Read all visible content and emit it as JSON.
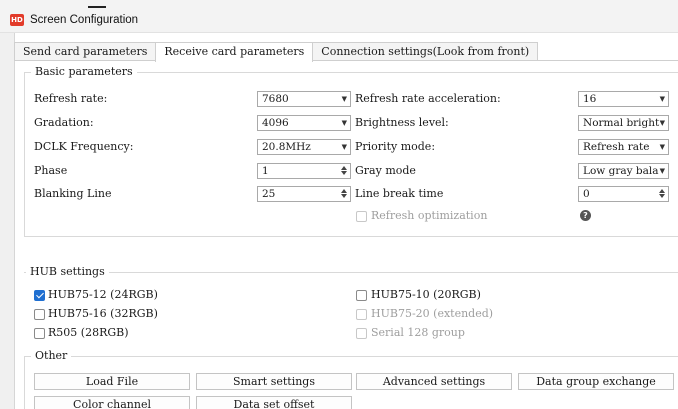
{
  "window": {
    "title": "Screen Configuration",
    "icon": "HD"
  },
  "tabs": [
    {
      "label": "Send card parameters"
    },
    {
      "label": "Receive card parameters"
    },
    {
      "label": "Connection settings(Look from front)"
    }
  ],
  "basic": {
    "title": "Basic parameters",
    "refresh_rate": {
      "label": "Refresh rate:",
      "value": "7680"
    },
    "refresh_accel": {
      "label": "Refresh rate acceleration:",
      "value": "16"
    },
    "gradation": {
      "label": "Gradation:",
      "value": "4096"
    },
    "brightness": {
      "label": "Brightness level:",
      "value": "Normal bright"
    },
    "dclk": {
      "label": "DCLK Frequency:",
      "value": "20.8MHz"
    },
    "priority": {
      "label": "Priority mode:",
      "value": "Refresh rate"
    },
    "phase": {
      "label": "Phase",
      "value": "1"
    },
    "gray": {
      "label": "Gray mode",
      "value": "Low gray bala"
    },
    "blanking": {
      "label": "Blanking Line",
      "value": "25"
    },
    "line_break": {
      "label": "Line break time",
      "value": "0"
    },
    "refresh_opt": {
      "label": "Refresh optimization",
      "checked": false,
      "enabled": false
    },
    "help_icon": "question-icon"
  },
  "hub": {
    "title": "HUB settings",
    "options": [
      {
        "label": "HUB75-12 (24RGB)",
        "checked": true,
        "enabled": true
      },
      {
        "label": "HUB75-10 (20RGB)",
        "checked": false,
        "enabled": true
      },
      {
        "label": "HUB75-16 (32RGB)",
        "checked": false,
        "enabled": true
      },
      {
        "label": "HUB75-20 (extended)",
        "checked": false,
        "enabled": false
      },
      {
        "label": "R505 (28RGB)",
        "checked": false,
        "enabled": true
      },
      {
        "label": "Serial 128 group",
        "checked": false,
        "enabled": false
      }
    ]
  },
  "other": {
    "title": "Other",
    "buttons": [
      {
        "label": "Load File"
      },
      {
        "label": "Smart settings"
      },
      {
        "label": "Advanced settings"
      },
      {
        "label": "Data group exchange"
      },
      {
        "label": "Color channel"
      },
      {
        "label": "Data set offset"
      }
    ]
  },
  "colors": {
    "accent": "#1f6fd1",
    "app_icon": "#e23b2a"
  }
}
